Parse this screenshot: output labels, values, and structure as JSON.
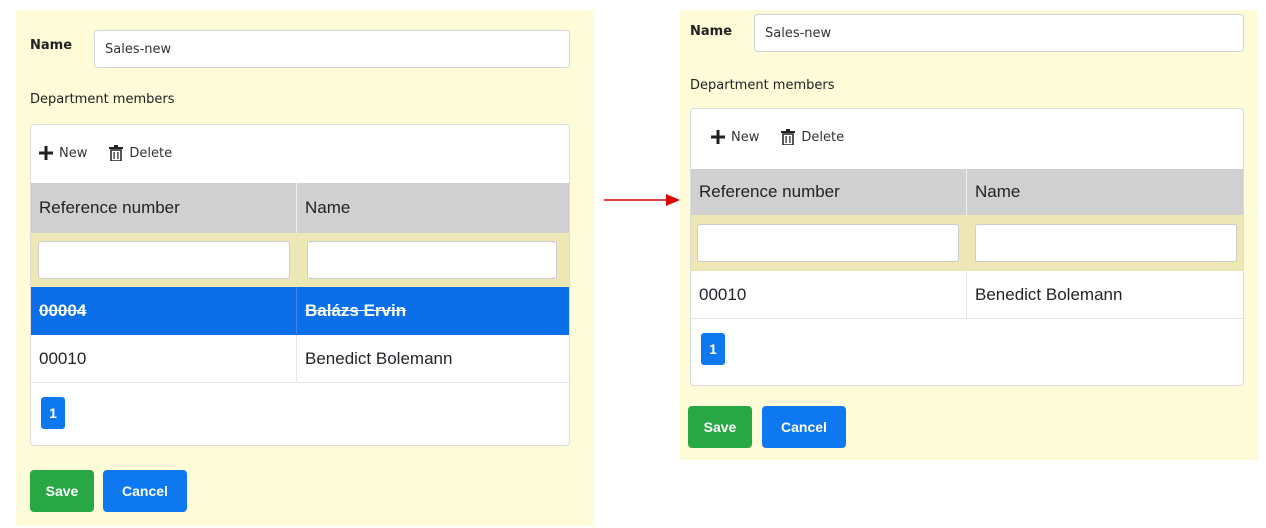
{
  "form": {
    "name_label": "Name",
    "name_value": "Sales-new",
    "dept_label": "Department members",
    "toolbar": {
      "new_label": "New",
      "delete_label": "Delete"
    },
    "columns": [
      "Reference number",
      "Name"
    ],
    "pagination_current": "1",
    "save_label": "Save",
    "cancel_label": "Cancel"
  },
  "before": {
    "rows": [
      {
        "ref": "00004",
        "name": "Balázs Ervin",
        "state": "selected, marked for deletion"
      },
      {
        "ref": "00010",
        "name": "Benedict Bolemann"
      }
    ]
  },
  "after": {
    "rows": [
      {
        "ref": "00010",
        "name": "Benedict Bolemann"
      }
    ]
  },
  "colors": {
    "panel_bg": "#fdfbd8",
    "header_bg": "#d0d0d0",
    "filter_bg": "#ece7b4",
    "selected_row": "#0a6fe8",
    "save": "#28a745",
    "cancel": "#0d78f0",
    "arrow": "#e00000"
  }
}
